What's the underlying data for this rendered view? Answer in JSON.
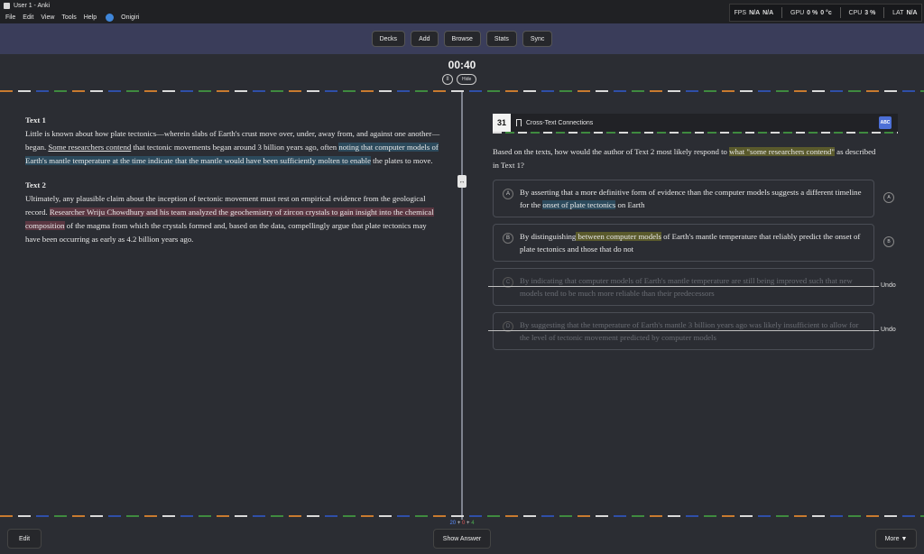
{
  "window": {
    "title": "User 1 - Anki",
    "min": "—",
    "max": "▢",
    "close": "✕"
  },
  "menu": {
    "file": "File",
    "edit": "Edit",
    "view": "View",
    "tools": "Tools",
    "help": "Help",
    "addon": "Onigiri"
  },
  "stats": {
    "fps_label": "FPS",
    "fps_value": "N/A",
    "fps_extra": "N/A",
    "gpu_label": "GPU",
    "gpu_value": "0 %",
    "gpu_temp": "0 °c",
    "cpu_label": "CPU",
    "cpu_value": "3 %",
    "lat_label": "LAT",
    "lat_value": "N/A"
  },
  "toolbar": {
    "decks": "Decks",
    "add": "Add",
    "browse": "Browse",
    "stats": "Stats",
    "sync": "Sync"
  },
  "timer": {
    "time": "00:40",
    "pause": "II",
    "hide": "Hide"
  },
  "passage": {
    "t1_title": "Text 1",
    "t1_a": "Little is known about how plate tectonics—wherein slabs of Earth's crust move over, under, away from, and against one another—began. ",
    "t1_b": "Some researchers contend",
    "t1_c": " that tectonic movements began around 3 billion years ago, often ",
    "t1_d": "noting that computer models of Earth's mantle temperature at the time indicate that the mantle would have been sufficiently molten to enable",
    "t1_e": " the plates to move.",
    "t2_title": "Text 2",
    "t2_a": "Ultimately, any plausible claim about the inception of tectonic movement must rest on empirical evidence from the geological record. ",
    "t2_b": "Researcher Wriju Chowdhury and his team analyzed the geochemistry of zircon crystals to gain insight into the chemical composition",
    "t2_c": " of the magma from which the crystals formed and, based on the data, compellingly argue that plate tectonics may have been occurring as early as 4.2 billion years ago."
  },
  "question": {
    "number": "31",
    "title": "Cross-Text Connections",
    "abc_icon": "ABC",
    "stem_a": "Based on the texts, how would the author of Text 2 most likely respond to ",
    "stem_b": "what \"some researchers contend\"",
    "stem_c": " as described in Text 1?",
    "choices": [
      {
        "letter": "A",
        "text_a": "By asserting that a more definitive form of evidence than the computer models suggests a different timeline for the ",
        "text_b": "onset of plate tectonics",
        "text_c": " on Earth"
      },
      {
        "letter": "B",
        "text_a": "By distinguishing",
        "text_b": " between computer models",
        "text_c": " of Earth's mantle temperature that reliably predict the onset of plate tectonics and those that do not"
      },
      {
        "letter": "C",
        "text": "By indicating that computer models of Earth's mantle temperature are still being improved such that new models tend to be much more reliable than their predecessors"
      },
      {
        "letter": "D",
        "text": "By suggesting that the temperature of Earth's mantle 3 billion years ago was likely insufficient to allow for the level of tectonic movement predicted by computer models"
      }
    ],
    "undo": "Undo"
  },
  "bottom": {
    "count_new": "20",
    "count_sep1": " + ",
    "count_learn": "0",
    "count_sep2": " + ",
    "count_rev": "4",
    "edit": "Edit",
    "show_answer": "Show Answer",
    "more": "More ▼"
  }
}
